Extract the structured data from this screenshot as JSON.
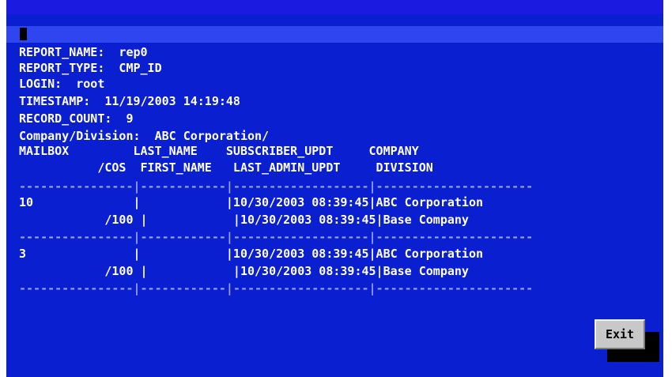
{
  "report": {
    "report_name_line": "REPORT_NAME:  rep0",
    "report_type_line": "REPORT_TYPE:  CMP_ID",
    "login_line": "LOGIN:  root",
    "timestamp_line": "TIMESTAMP:  11/19/2003 14:19:48",
    "record_count_line": "RECORD_COUNT:  9",
    "company_division_line": "Company/Division:  ABC Corporation/"
  },
  "table": {
    "header_row_1": "MAILBOX         LAST_NAME    SUBSCRIBER_UPDT     COMPANY",
    "header_row_2": "           /COS  FIRST_NAME   LAST_ADMIN_UPDT     DIVISION",
    "separator": "----------------|------------|-------------------|----------------------",
    "rows": [
      {
        "line1": "10              |            |10/30/2003 08:39:45|ABC Corporation",
        "line2": "            /100 |            |10/30/2003 08:39:45|Base Company",
        "separator": "----------------|------------|-------------------|----------------------"
      },
      {
        "line1": "3               |            |10/30/2003 08:39:45|ABC Corporation",
        "line2": "            /100 |            |10/30/2003 08:39:45|Base Company",
        "separator": "----------------|------------|-------------------|----------------------"
      }
    ]
  },
  "buttons": {
    "exit_label": "Exit"
  },
  "colors": {
    "background": "#0a1fd0",
    "highlight_bar": "#2f45f0",
    "text": "#ffffff",
    "button_face": "#c8c8c8"
  }
}
